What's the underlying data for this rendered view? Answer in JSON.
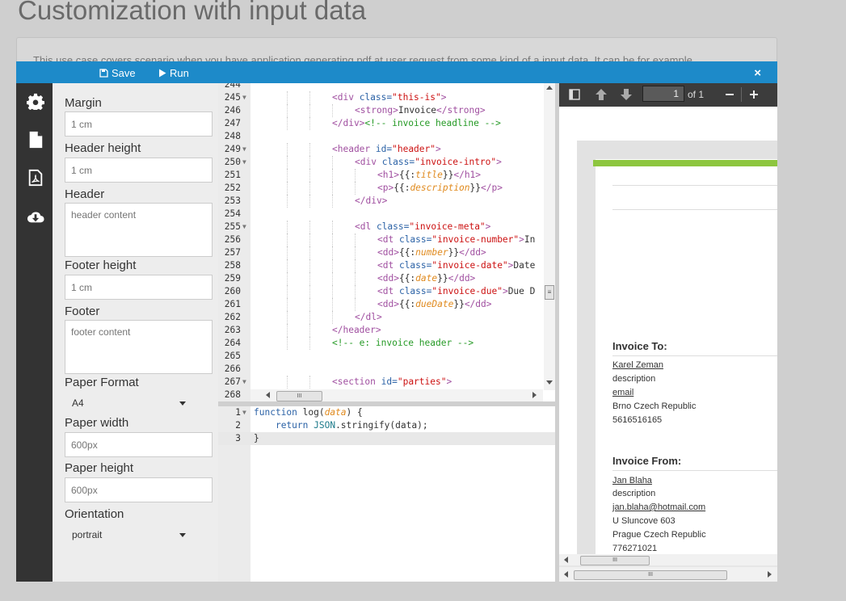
{
  "page": {
    "title": "Customization with input data",
    "description": "This use case covers scenario when you have application generating pdf at user request from some kind of a input data. It can be for example"
  },
  "toolbar": {
    "save_label": "Save",
    "run_label": "Run",
    "close_label": "×"
  },
  "sidebar": {
    "icons": [
      "gear-icon",
      "file-icon",
      "pdf-icon",
      "cloud-download-icon"
    ]
  },
  "form": {
    "margin": {
      "label": "Margin",
      "placeholder": "1 cm"
    },
    "header_height": {
      "label": "Header height",
      "placeholder": "1 cm"
    },
    "header": {
      "label": "Header",
      "placeholder": "header content"
    },
    "footer_height": {
      "label": "Footer height",
      "placeholder": "1 cm"
    },
    "footer": {
      "label": "Footer",
      "placeholder": "footer content"
    },
    "paper_format": {
      "label": "Paper Format",
      "value": "A4"
    },
    "paper_width": {
      "label": "Paper width",
      "placeholder": "600px"
    },
    "paper_height": {
      "label": "Paper height",
      "placeholder": "600px"
    },
    "orientation": {
      "label": "Orientation",
      "value": "portrait"
    }
  },
  "html_editor": {
    "lines": [
      {
        "n": "244",
        "fold": false,
        "indent": 0,
        "tokens": []
      },
      {
        "n": "245",
        "fold": true,
        "indent": 3,
        "tokens": [
          [
            "t-tag",
            "<div "
          ],
          [
            "t-attr",
            "class="
          ],
          [
            "t-str",
            "\"this-is\""
          ],
          [
            "t-tag",
            ">"
          ]
        ]
      },
      {
        "n": "246",
        "fold": false,
        "indent": 4,
        "tokens": [
          [
            "t-tag",
            "<strong>"
          ],
          [
            "",
            "Invoice"
          ],
          [
            "t-tag",
            "</strong>"
          ]
        ]
      },
      {
        "n": "247",
        "fold": false,
        "indent": 3,
        "tokens": [
          [
            "t-tag",
            "</div>"
          ],
          [
            "t-com",
            "<!-- invoice headline -->"
          ]
        ]
      },
      {
        "n": "248",
        "fold": false,
        "indent": 0,
        "tokens": []
      },
      {
        "n": "249",
        "fold": true,
        "indent": 3,
        "tokens": [
          [
            "t-tag",
            "<header "
          ],
          [
            "t-attr",
            "id="
          ],
          [
            "t-str",
            "\"header\""
          ],
          [
            "t-tag",
            ">"
          ]
        ]
      },
      {
        "n": "250",
        "fold": true,
        "indent": 4,
        "tokens": [
          [
            "t-tag",
            "<div "
          ],
          [
            "t-attr",
            "class="
          ],
          [
            "t-str",
            "\"invoice-intro\""
          ],
          [
            "t-tag",
            ">"
          ]
        ]
      },
      {
        "n": "251",
        "fold": false,
        "indent": 5,
        "tokens": [
          [
            "t-tag",
            "<h1>"
          ],
          [
            "",
            "{{:"
          ],
          [
            "t-var",
            "title"
          ],
          [
            "",
            "}}"
          ],
          [
            "t-tag",
            "</h1>"
          ]
        ]
      },
      {
        "n": "252",
        "fold": false,
        "indent": 5,
        "tokens": [
          [
            "t-tag",
            "<p>"
          ],
          [
            "",
            "{{:"
          ],
          [
            "t-var",
            "description"
          ],
          [
            "",
            "}}"
          ],
          [
            "t-tag",
            "</p>"
          ]
        ]
      },
      {
        "n": "253",
        "fold": false,
        "indent": 4,
        "tokens": [
          [
            "t-tag",
            "</div>"
          ]
        ]
      },
      {
        "n": "254",
        "fold": false,
        "indent": 0,
        "tokens": []
      },
      {
        "n": "255",
        "fold": true,
        "indent": 4,
        "tokens": [
          [
            "t-tag",
            "<dl "
          ],
          [
            "t-attr",
            "class="
          ],
          [
            "t-str",
            "\"invoice-meta\""
          ],
          [
            "t-tag",
            ">"
          ]
        ]
      },
      {
        "n": "256",
        "fold": false,
        "indent": 5,
        "tokens": [
          [
            "t-tag",
            "<dt "
          ],
          [
            "t-attr",
            "class="
          ],
          [
            "t-str",
            "\"invoice-number\""
          ],
          [
            "t-tag",
            ">"
          ],
          [
            "",
            "In"
          ]
        ]
      },
      {
        "n": "257",
        "fold": false,
        "indent": 5,
        "tokens": [
          [
            "t-tag",
            "<dd>"
          ],
          [
            "",
            "{{:"
          ],
          [
            "t-var",
            "number"
          ],
          [
            "",
            "}}"
          ],
          [
            "t-tag",
            "</dd>"
          ]
        ]
      },
      {
        "n": "258",
        "fold": false,
        "indent": 5,
        "tokens": [
          [
            "t-tag",
            "<dt "
          ],
          [
            "t-attr",
            "class="
          ],
          [
            "t-str",
            "\"invoice-date\""
          ],
          [
            "t-tag",
            ">"
          ],
          [
            "",
            "Date"
          ]
        ]
      },
      {
        "n": "259",
        "fold": false,
        "indent": 5,
        "tokens": [
          [
            "t-tag",
            "<dd>"
          ],
          [
            "",
            "{{:"
          ],
          [
            "t-var",
            "date"
          ],
          [
            "",
            "}}"
          ],
          [
            "t-tag",
            "</dd>"
          ]
        ]
      },
      {
        "n": "260",
        "fold": false,
        "indent": 5,
        "tokens": [
          [
            "t-tag",
            "<dt "
          ],
          [
            "t-attr",
            "class="
          ],
          [
            "t-str",
            "\"invoice-due\""
          ],
          [
            "t-tag",
            ">"
          ],
          [
            "",
            "Due D"
          ]
        ]
      },
      {
        "n": "261",
        "fold": false,
        "indent": 5,
        "tokens": [
          [
            "t-tag",
            "<dd>"
          ],
          [
            "",
            "{{:"
          ],
          [
            "t-var",
            "dueDate"
          ],
          [
            "",
            "}}"
          ],
          [
            "t-tag",
            "</dd>"
          ]
        ]
      },
      {
        "n": "262",
        "fold": false,
        "indent": 4,
        "tokens": [
          [
            "t-tag",
            "</dl>"
          ]
        ]
      },
      {
        "n": "263",
        "fold": false,
        "indent": 3,
        "tokens": [
          [
            "t-tag",
            "</header>"
          ]
        ]
      },
      {
        "n": "264",
        "fold": false,
        "indent": 3,
        "tokens": [
          [
            "t-com",
            "<!-- e: invoice header -->"
          ]
        ]
      },
      {
        "n": "265",
        "fold": false,
        "indent": 0,
        "tokens": []
      },
      {
        "n": "266",
        "fold": false,
        "indent": 0,
        "tokens": []
      },
      {
        "n": "267",
        "fold": true,
        "indent": 3,
        "tokens": [
          [
            "t-tag",
            "<section "
          ],
          [
            "t-attr",
            "id="
          ],
          [
            "t-str",
            "\"parties\""
          ],
          [
            "t-tag",
            ">"
          ]
        ]
      },
      {
        "n": "268",
        "fold": false,
        "indent": 0,
        "tokens": []
      }
    ],
    "scroll_grip": "III"
  },
  "js_editor": {
    "lines": [
      {
        "n": "1",
        "fold": true,
        "tokens": [
          [
            "t-kw",
            "function "
          ],
          [
            "",
            "log("
          ],
          [
            "t-var",
            "data"
          ],
          [
            "",
            ") {"
          ]
        ]
      },
      {
        "n": "2",
        "fold": false,
        "tokens": [
          [
            "",
            "    "
          ],
          [
            "t-kw",
            "return "
          ],
          [
            "t-fn",
            "JSON"
          ],
          [
            "",
            ".stringify(data);"
          ]
        ]
      },
      {
        "n": "3",
        "fold": false,
        "tokens": [
          [
            "",
            "}"
          ]
        ]
      }
    ]
  },
  "pdf": {
    "page_number": "1",
    "page_count": "of 1",
    "invoice_to": {
      "heading": "Invoice To:",
      "name": "Karel Zeman",
      "description": "description",
      "email": "email",
      "address": "Brno Czech Republic",
      "phone": "5616516165"
    },
    "invoice_from": {
      "heading": "Invoice From:",
      "name": "Jan Blaha",
      "description": "description",
      "email": "jan.blaha@hotmail.com",
      "street": "U Sluncove 603",
      "address": "Prague Czech Republic",
      "phone": "776271021"
    },
    "scroll_grip": "III"
  },
  "colors": {
    "toolbar": "#1d8ac9",
    "sidebar": "#333333",
    "pdf_accent": "#8dc63f"
  }
}
